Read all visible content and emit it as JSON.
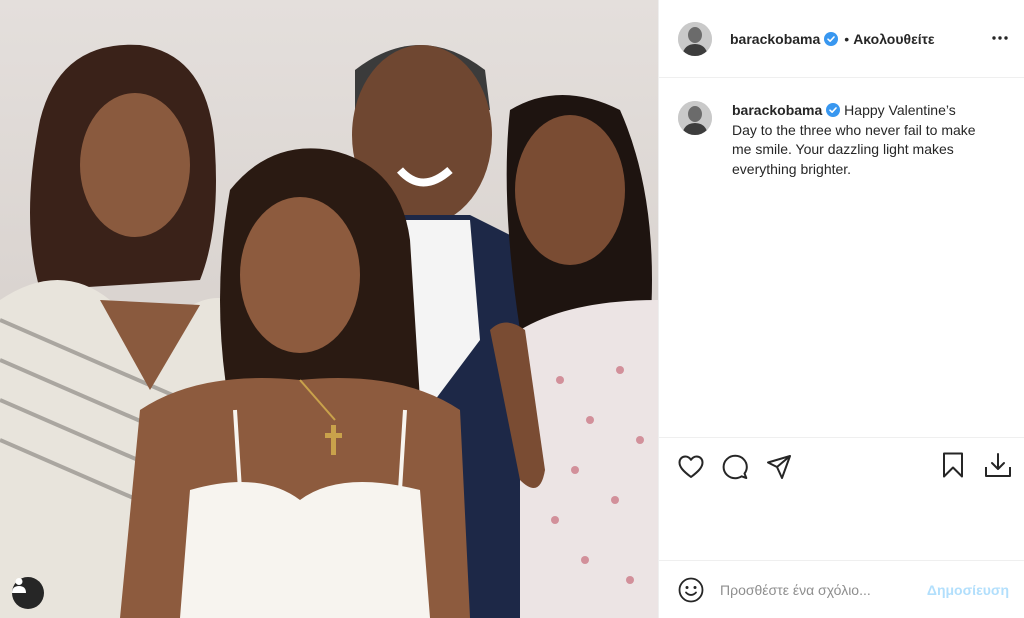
{
  "post": {
    "author": "barackobama",
    "verified_icon": "verified-badge-icon",
    "separator": "•",
    "follow_status": "Ακολουθείτε",
    "caption": "Happy Valentine’s Day to the three who never fail to make me smile. Your dazzling light makes everything brighter.",
    "photo_icon": "tagged-user-icon"
  },
  "actions": {
    "icons": [
      "heart-icon",
      "comment-icon",
      "share-icon",
      "bookmark-icon",
      "download-icon"
    ]
  },
  "comment": {
    "placeholder": "Προσθέστε ένα σχόλιο...",
    "post_label": "Δημοσίευση"
  },
  "colors": {
    "verified": "#3897f0",
    "post_button_disabled": "#b2dffc",
    "divider": "#efefef",
    "text": "#262626",
    "placeholder": "#8e8e8e"
  }
}
